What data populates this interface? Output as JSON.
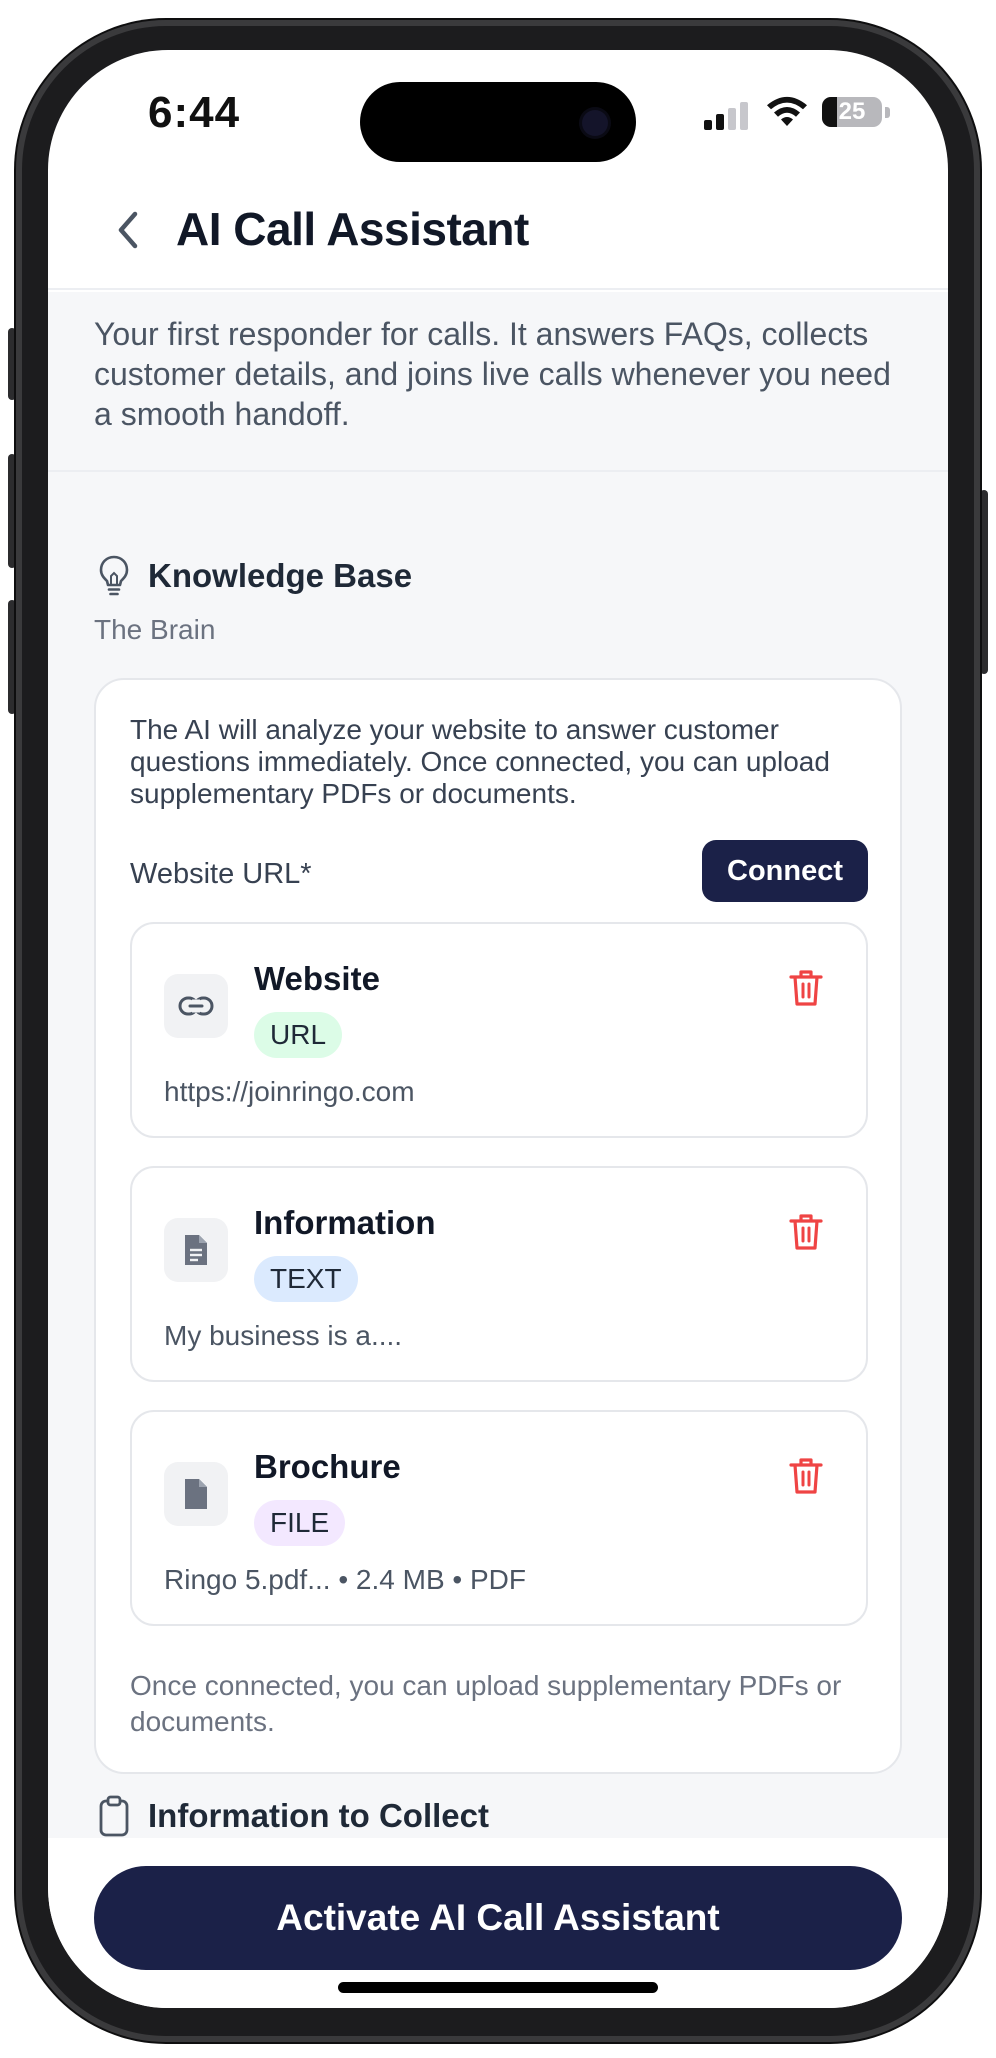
{
  "status_bar": {
    "time": "6:44",
    "battery_level": "25",
    "battery_fraction": 0.25,
    "signal_bars_active": 2,
    "signal_bars_total": 4
  },
  "header": {
    "title": "AI Call Assistant",
    "back_icon": "chevron-left-icon"
  },
  "intro": "Your first responder for calls. It answers FAQs, collects customer details, and joins live calls whenever you need a smooth handoff.",
  "knowledge_base": {
    "icon": "lightbulb-icon",
    "title": "Knowledge Base",
    "subtitle": "The Brain",
    "description": "The AI will analyze your website to answer customer questions immediately. Once connected, you can upload supplementary PDFs or documents.",
    "url_label": "Website URL*",
    "connect_label": "Connect",
    "sources": [
      {
        "name": "Website",
        "type": "URL",
        "detail": "https://joinringo.com",
        "icon": "link-icon",
        "badge_color": "#dcfce7"
      },
      {
        "name": "Information",
        "type": "TEXT",
        "detail": "My business is a....",
        "icon": "text-document-icon",
        "badge_color": "#dbeafe"
      },
      {
        "name": "Brochure",
        "type": "FILE",
        "detail": "Ringo 5.pdf... • 2.4 MB • PDF",
        "icon": "file-icon",
        "badge_color": "#f3e8ff"
      }
    ],
    "footer_note": "Once connected, you can upload supplementary PDFs or documents."
  },
  "collect_section": {
    "icon": "clipboard-icon",
    "title": "Information to Collect"
  },
  "activate_label": "Activate AI Call Assistant",
  "colors": {
    "primary": "#1b2148",
    "danger": "#ef4444",
    "content_bg": "#f6f7f9"
  }
}
